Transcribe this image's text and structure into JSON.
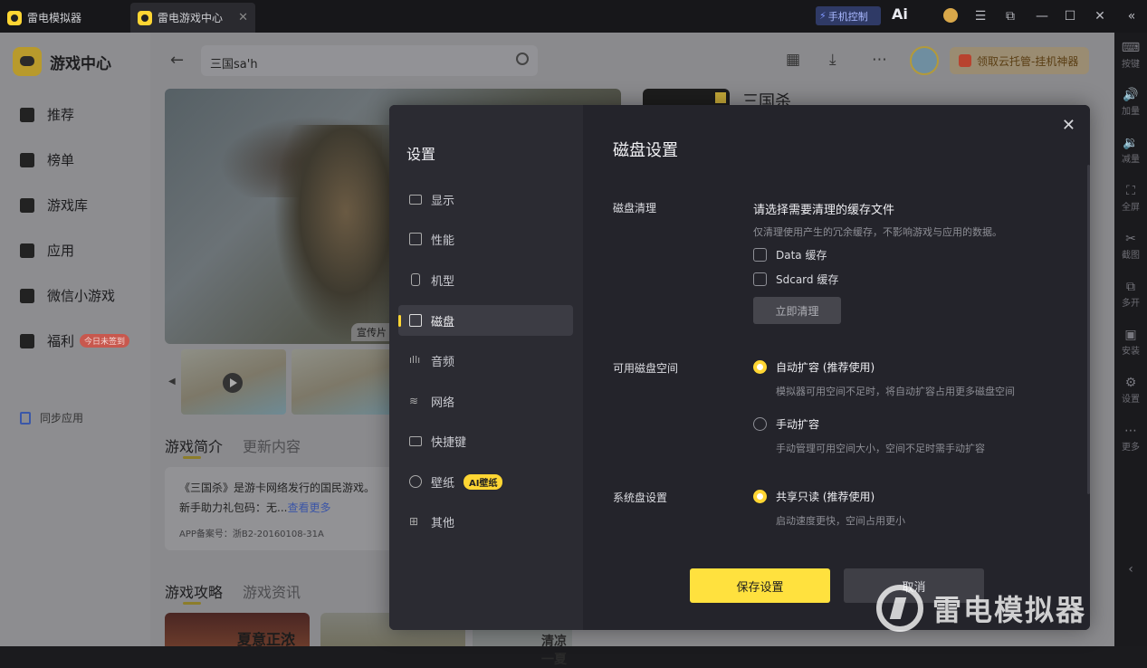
{
  "titlebar": {
    "tabs": [
      {
        "label": "雷电模拟器"
      },
      {
        "label": "雷电游戏中心"
      }
    ],
    "phone_control": "手机控制",
    "ai_label": "Ai"
  },
  "right_toolbar": [
    {
      "label": "按键",
      "icon": "keyboard-icon"
    },
    {
      "label": "加量",
      "icon": "volume-up-icon"
    },
    {
      "label": "减量",
      "icon": "volume-down-icon"
    },
    {
      "label": "全屏",
      "icon": "fullscreen-icon"
    },
    {
      "label": "截图",
      "icon": "scissors-icon"
    },
    {
      "label": "多开",
      "icon": "multi-instance-icon"
    },
    {
      "label": "安装",
      "icon": "install-icon"
    },
    {
      "label": "设置",
      "icon": "gear-icon"
    },
    {
      "label": "更多",
      "icon": "more-icon"
    }
  ],
  "sidebar": {
    "brand": "游戏中心",
    "items": [
      {
        "label": "推荐",
        "icon": "flame-icon"
      },
      {
        "label": "榜单",
        "icon": "ranking-icon"
      },
      {
        "label": "游戏库",
        "icon": "gamepad-icon"
      },
      {
        "label": "应用",
        "icon": "apps-icon"
      },
      {
        "label": "微信小游戏",
        "icon": "wechat-game-icon"
      },
      {
        "label": "福利",
        "icon": "gift-icon",
        "badge": "今日未签到"
      }
    ],
    "sync": "同步应用"
  },
  "header": {
    "search_value": "三国sa'h",
    "cloud_button": "领取云托管-挂机神器"
  },
  "page": {
    "banner_tag": "宣传片",
    "tabs1": [
      "游戏简介",
      "更新内容"
    ],
    "desc_line1": "《三国杀》是游卡网络发行的国民游戏。",
    "desc_line2": "新手助力礼包码：无...",
    "desc_more": "查看更多",
    "record": "APP备案号：浙B2-20160108-31A",
    "tabs2": [
      "游戏攻略",
      "游戏资讯"
    ],
    "card1_title": "夏意正浓",
    "card3_title": "清凉一夏",
    "game_name": "三国杀"
  },
  "modal": {
    "side_title": "设置",
    "menu": [
      {
        "label": "显示",
        "icon": "monitor-icon"
      },
      {
        "label": "性能",
        "icon": "performance-icon"
      },
      {
        "label": "机型",
        "icon": "phone-icon"
      },
      {
        "label": "磁盘",
        "icon": "disk-icon",
        "active": true
      },
      {
        "label": "音频",
        "icon": "audio-icon"
      },
      {
        "label": "网络",
        "icon": "wifi-icon"
      },
      {
        "label": "快捷键",
        "icon": "shortcut-keyboard-icon"
      },
      {
        "label": "壁纸",
        "icon": "palette-icon",
        "badge": "AI壁纸"
      },
      {
        "label": "其他",
        "icon": "grid-icon"
      }
    ],
    "heading": "磁盘设置",
    "cleanup": {
      "label": "磁盘清理",
      "title": "请选择需要清理的缓存文件",
      "sub": "仅清理使用产生的冗余缓存，不影响游戏与应用的数据。",
      "options": [
        "Data 缓存",
        "Sdcard 缓存"
      ],
      "button": "立即清理"
    },
    "space": {
      "label": "可用磁盘空间",
      "options": [
        {
          "label": "自动扩容 (推荐使用)",
          "sub": "模拟器可用空间不足时，将自动扩容占用更多磁盘空间",
          "selected": true
        },
        {
          "label": "手动扩容",
          "sub": "手动管理可用空间大小，空间不足时需手动扩容",
          "selected": false
        }
      ]
    },
    "system": {
      "label": "系统盘设置",
      "options": [
        {
          "label": "共享只读 (推荐使用)",
          "sub": "启动速度更快，空间占用更小",
          "selected": true
        }
      ]
    },
    "save": "保存设置",
    "cancel": "取消"
  },
  "watermark": "雷电模拟器",
  "colors": {
    "accent": "#ffd633",
    "modal_bg": "#24242b",
    "modal_side_bg": "#2b2b32"
  }
}
